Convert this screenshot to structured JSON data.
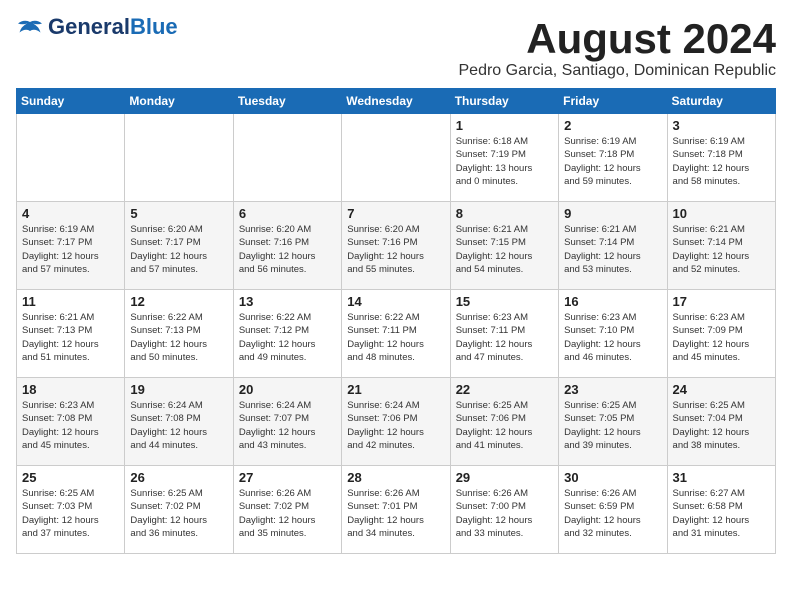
{
  "header": {
    "logo_general": "General",
    "logo_blue": "Blue",
    "month_year": "August 2024",
    "location": "Pedro Garcia, Santiago, Dominican Republic"
  },
  "weekdays": [
    "Sunday",
    "Monday",
    "Tuesday",
    "Wednesday",
    "Thursday",
    "Friday",
    "Saturday"
  ],
  "weeks": [
    [
      {
        "day": "",
        "content": ""
      },
      {
        "day": "",
        "content": ""
      },
      {
        "day": "",
        "content": ""
      },
      {
        "day": "",
        "content": ""
      },
      {
        "day": "1",
        "content": "Sunrise: 6:18 AM\nSunset: 7:19 PM\nDaylight: 13 hours\nand 0 minutes."
      },
      {
        "day": "2",
        "content": "Sunrise: 6:19 AM\nSunset: 7:18 PM\nDaylight: 12 hours\nand 59 minutes."
      },
      {
        "day": "3",
        "content": "Sunrise: 6:19 AM\nSunset: 7:18 PM\nDaylight: 12 hours\nand 58 minutes."
      }
    ],
    [
      {
        "day": "4",
        "content": "Sunrise: 6:19 AM\nSunset: 7:17 PM\nDaylight: 12 hours\nand 57 minutes."
      },
      {
        "day": "5",
        "content": "Sunrise: 6:20 AM\nSunset: 7:17 PM\nDaylight: 12 hours\nand 57 minutes."
      },
      {
        "day": "6",
        "content": "Sunrise: 6:20 AM\nSunset: 7:16 PM\nDaylight: 12 hours\nand 56 minutes."
      },
      {
        "day": "7",
        "content": "Sunrise: 6:20 AM\nSunset: 7:16 PM\nDaylight: 12 hours\nand 55 minutes."
      },
      {
        "day": "8",
        "content": "Sunrise: 6:21 AM\nSunset: 7:15 PM\nDaylight: 12 hours\nand 54 minutes."
      },
      {
        "day": "9",
        "content": "Sunrise: 6:21 AM\nSunset: 7:14 PM\nDaylight: 12 hours\nand 53 minutes."
      },
      {
        "day": "10",
        "content": "Sunrise: 6:21 AM\nSunset: 7:14 PM\nDaylight: 12 hours\nand 52 minutes."
      }
    ],
    [
      {
        "day": "11",
        "content": "Sunrise: 6:21 AM\nSunset: 7:13 PM\nDaylight: 12 hours\nand 51 minutes."
      },
      {
        "day": "12",
        "content": "Sunrise: 6:22 AM\nSunset: 7:13 PM\nDaylight: 12 hours\nand 50 minutes."
      },
      {
        "day": "13",
        "content": "Sunrise: 6:22 AM\nSunset: 7:12 PM\nDaylight: 12 hours\nand 49 minutes."
      },
      {
        "day": "14",
        "content": "Sunrise: 6:22 AM\nSunset: 7:11 PM\nDaylight: 12 hours\nand 48 minutes."
      },
      {
        "day": "15",
        "content": "Sunrise: 6:23 AM\nSunset: 7:11 PM\nDaylight: 12 hours\nand 47 minutes."
      },
      {
        "day": "16",
        "content": "Sunrise: 6:23 AM\nSunset: 7:10 PM\nDaylight: 12 hours\nand 46 minutes."
      },
      {
        "day": "17",
        "content": "Sunrise: 6:23 AM\nSunset: 7:09 PM\nDaylight: 12 hours\nand 45 minutes."
      }
    ],
    [
      {
        "day": "18",
        "content": "Sunrise: 6:23 AM\nSunset: 7:08 PM\nDaylight: 12 hours\nand 45 minutes."
      },
      {
        "day": "19",
        "content": "Sunrise: 6:24 AM\nSunset: 7:08 PM\nDaylight: 12 hours\nand 44 minutes."
      },
      {
        "day": "20",
        "content": "Sunrise: 6:24 AM\nSunset: 7:07 PM\nDaylight: 12 hours\nand 43 minutes."
      },
      {
        "day": "21",
        "content": "Sunrise: 6:24 AM\nSunset: 7:06 PM\nDaylight: 12 hours\nand 42 minutes."
      },
      {
        "day": "22",
        "content": "Sunrise: 6:25 AM\nSunset: 7:06 PM\nDaylight: 12 hours\nand 41 minutes."
      },
      {
        "day": "23",
        "content": "Sunrise: 6:25 AM\nSunset: 7:05 PM\nDaylight: 12 hours\nand 39 minutes."
      },
      {
        "day": "24",
        "content": "Sunrise: 6:25 AM\nSunset: 7:04 PM\nDaylight: 12 hours\nand 38 minutes."
      }
    ],
    [
      {
        "day": "25",
        "content": "Sunrise: 6:25 AM\nSunset: 7:03 PM\nDaylight: 12 hours\nand 37 minutes."
      },
      {
        "day": "26",
        "content": "Sunrise: 6:25 AM\nSunset: 7:02 PM\nDaylight: 12 hours\nand 36 minutes."
      },
      {
        "day": "27",
        "content": "Sunrise: 6:26 AM\nSunset: 7:02 PM\nDaylight: 12 hours\nand 35 minutes."
      },
      {
        "day": "28",
        "content": "Sunrise: 6:26 AM\nSunset: 7:01 PM\nDaylight: 12 hours\nand 34 minutes."
      },
      {
        "day": "29",
        "content": "Sunrise: 6:26 AM\nSunset: 7:00 PM\nDaylight: 12 hours\nand 33 minutes."
      },
      {
        "day": "30",
        "content": "Sunrise: 6:26 AM\nSunset: 6:59 PM\nDaylight: 12 hours\nand 32 minutes."
      },
      {
        "day": "31",
        "content": "Sunrise: 6:27 AM\nSunset: 6:58 PM\nDaylight: 12 hours\nand 31 minutes."
      }
    ]
  ]
}
